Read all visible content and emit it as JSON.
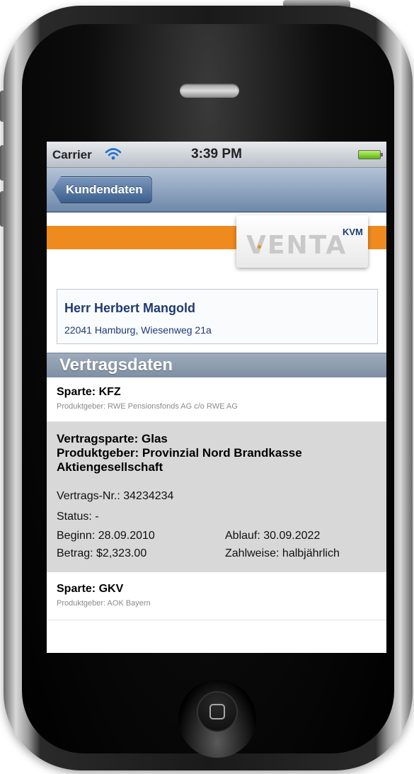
{
  "status_bar": {
    "carrier": "Carrier",
    "time": "3:39 PM"
  },
  "nav": {
    "back_label": "Kundendaten"
  },
  "logo": {
    "text": "VENTA",
    "sup": "KVM"
  },
  "customer": {
    "name": "Herr Herbert Mangold",
    "address": "22041 Hamburg, Wiesenweg 21a"
  },
  "section": {
    "title": "Vertragsdaten"
  },
  "contracts": [
    {
      "title": "Sparte: KFZ",
      "subtitle": "Produktgeber: RWE Pensionsfonds AG c/o RWE AG"
    },
    {
      "title_line1": "Vertragsparte: Glas",
      "title_line2": "Produktgeber: Provinzial Nord Brandkasse",
      "title_line3": "Aktiengesellschaft",
      "contract_no": "Vertrags-Nr.: 34234234",
      "status": "Status: -",
      "start": "Beginn: 28.09.2010",
      "end": "Ablauf: 30.09.2022",
      "amount": "Betrag: $2,323.00",
      "payment": "Zahlweise: halbjährlich"
    },
    {
      "title": "Sparte: GKV",
      "subtitle": "Produktgeber: AOK Bayern"
    }
  ],
  "colors": {
    "accent_orange": "#ef8a1e",
    "nav_blue": "#6d88aa",
    "name_blue": "#1f3a72"
  },
  "icons": [
    "wifi-icon",
    "battery-icon",
    "home-button-icon"
  ]
}
